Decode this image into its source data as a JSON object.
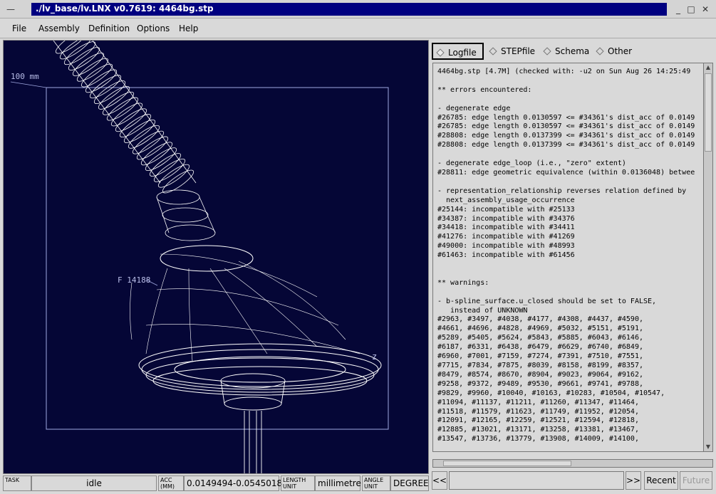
{
  "window": {
    "title": "./lv_base/lv.LNX v0.7619: 4464bg.stp"
  },
  "menu": {
    "items": [
      "File",
      "Assembly",
      "Definition",
      "Options",
      "Help"
    ]
  },
  "viewport": {
    "scale_label": "100 mm",
    "feature_label": "F 14188",
    "axis_label": "z",
    "background_color": "#050636",
    "wire_color": "#ffffff"
  },
  "tabs": [
    {
      "label": "Logfile",
      "active": true
    },
    {
      "label": "STEPfile",
      "active": false
    },
    {
      "label": "Schema",
      "active": false
    },
    {
      "label": "Other",
      "active": false
    }
  ],
  "log_lines": [
    "4464bg.stp [4.7M] (checked with: -u2 on Sun Aug 26 14:25:49",
    "",
    "** errors encountered:",
    "",
    "- degenerate edge",
    "#26785: edge length 0.0130597 <= #34361's dist_acc of 0.0149",
    "#26785: edge length 0.0130597 <= #34361's dist_acc of 0.0149",
    "#28808: edge length 0.0137399 <= #34361's dist_acc of 0.0149",
    "#28808: edge length 0.0137399 <= #34361's dist_acc of 0.0149",
    "",
    "- degenerate edge_loop (i.e., \"zero\" extent)",
    "#28811: edge geometric equivalence (within 0.0136048) betwee",
    "",
    "- representation_relationship reverses relation defined by",
    "  next_assembly_usage_occurrence",
    "#25144: incompatible with #25133",
    "#34387: incompatible with #34376",
    "#34418: incompatible with #34411",
    "#41276: incompatible with #41269",
    "#49000: incompatible with #48993",
    "#61463: incompatible with #61456",
    "",
    "",
    "** warnings:",
    "",
    "- b-spline_surface.u_closed should be set to FALSE,",
    "   instead of UNKNOWN",
    "#2963, #3497, #4038, #4177, #4308, #4437, #4590,",
    "#4661, #4696, #4828, #4969, #5032, #5151, #5191,",
    "#5289, #5405, #5624, #5843, #5885, #6043, #6146,",
    "#6187, #6331, #6438, #6479, #6629, #6740, #6849,",
    "#6960, #7001, #7159, #7274, #7391, #7510, #7551,",
    "#7715, #7834, #7875, #8039, #8158, #8199, #8357,",
    "#8479, #8574, #8670, #8904, #9023, #9064, #9162,",
    "#9258, #9372, #9489, #9530, #9661, #9741, #9788,",
    "#9829, #9960, #10040, #10163, #10283, #10504, #10547,",
    "#11094, #11137, #11211, #11260, #11347, #11464,",
    "#11518, #11579, #11623, #11749, #11952, #12054,",
    "#12091, #12165, #12259, #12521, #12594, #12818,",
    "#12885, #13021, #13171, #13258, #13381, #13467,",
    "#13547, #13736, #13779, #13908, #14009, #14100,"
  ],
  "input_row": {
    "prev_label": "<<",
    "next_label": ">>",
    "recent_label": "Recent",
    "future_label": "Future",
    "command_value": ""
  },
  "status": {
    "task_label": "TASK",
    "task_value": "idle",
    "acc_label_1": "ACC",
    "acc_label_2": "(MM)",
    "acc_value": "0.0149494-0.0545018",
    "length_label_1": "LENGTH",
    "length_label_2": "UNIT",
    "length_value": "millimetre",
    "angle_label_1": "ANGLE",
    "angle_label_2": "UNIT",
    "angle_value": "DEGREE"
  }
}
